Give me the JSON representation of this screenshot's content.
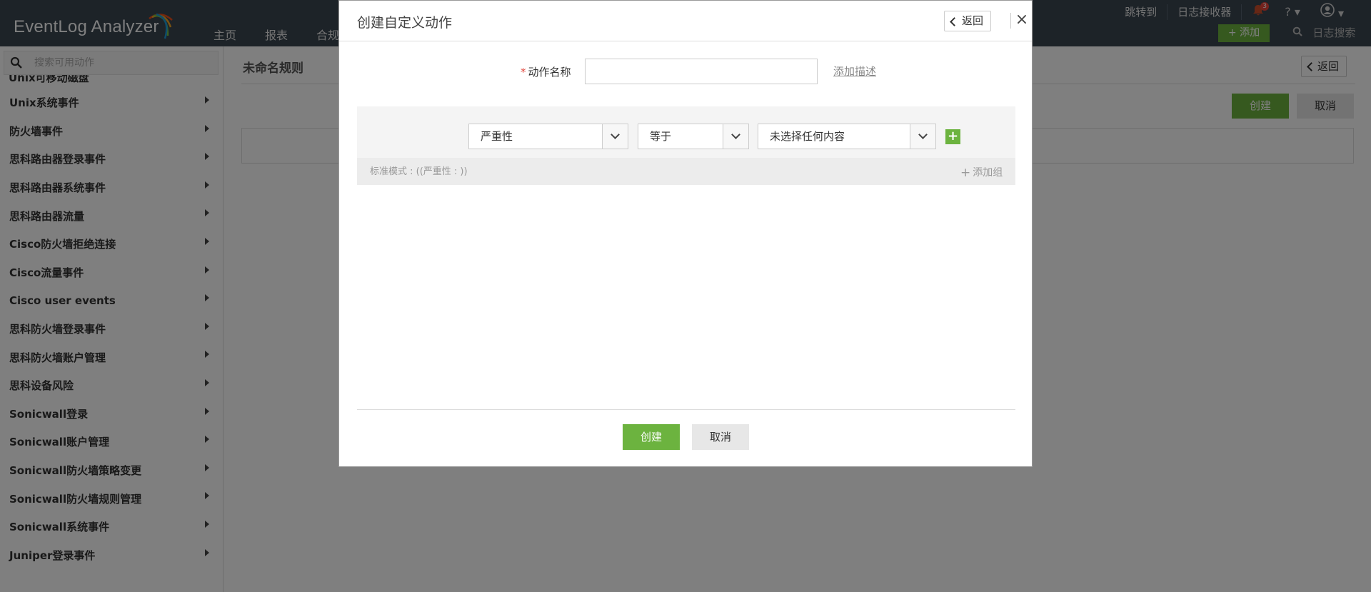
{
  "app": {
    "logo_text": "EventLog Analyzer",
    "nav": [
      "主页",
      "报表",
      "合规"
    ],
    "top_links": {
      "jump_to": "跳转到",
      "log_receiver": "日志接收器"
    },
    "bell_count": "3",
    "help": "?",
    "add_label": "添加",
    "log_search": "日志搜索"
  },
  "sidebar": {
    "search_placeholder": "搜索可用动作",
    "cut_item": "Unix可移动磁盘",
    "items": [
      {
        "label": "Unix系统事件"
      },
      {
        "label": "防火墙事件"
      },
      {
        "label": "思科路由器登录事件"
      },
      {
        "label": "思科路由器系统事件"
      },
      {
        "label": "思科路由器流量"
      },
      {
        "label": "Cisco防火墙拒绝连接"
      },
      {
        "label": "Cisco流量事件"
      },
      {
        "label": "Cisco user events"
      },
      {
        "label": "思科防火墙登录事件"
      },
      {
        "label": "思科防火墙账户管理"
      },
      {
        "label": "思科设备风险"
      },
      {
        "label": "Sonicwall登录"
      },
      {
        "label": "Sonicwall账户管理"
      },
      {
        "label": "Sonicwall防火墙策略变更"
      },
      {
        "label": "Sonicwall防火墙规则管理"
      },
      {
        "label": "Sonicwall系统事件"
      },
      {
        "label": "Juniper登录事件"
      }
    ]
  },
  "main": {
    "rule_title": "未命名规则",
    "back_label": "返回",
    "create_label": "创建",
    "cancel_label": "取消"
  },
  "modal": {
    "title": "创建自定义动作",
    "back_label": "返回",
    "close_icon": "×",
    "name_label": "动作名称",
    "name_value": "",
    "add_description": "添加描述",
    "condition": {
      "field": "严重性",
      "operator": "等于",
      "value": "未选择任何内容"
    },
    "pattern_text": "标准模式 : ((严重性 : ))",
    "add_group": "添加组",
    "create_label": "创建",
    "cancel_label": "取消"
  },
  "colors": {
    "accent": "#6cb33f",
    "topbar": "#3a4651",
    "badge": "#e8443a"
  }
}
